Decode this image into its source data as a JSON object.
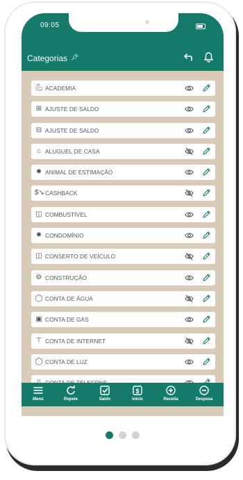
{
  "status": {
    "time": "09:05"
  },
  "header": {
    "title": "Categorias",
    "pin_icon": "pin-icon",
    "back_icon": "back-icon",
    "bell_icon": "bell-icon"
  },
  "categories": [
    {
      "label": "ACADEMIA",
      "icon": "dumbbell-icon",
      "hidden": false
    },
    {
      "label": "AJUSTE DE SALDO",
      "icon": "plus-box-icon",
      "hidden": false
    },
    {
      "label": "AJUSTE DE SALDO",
      "icon": "minus-box-icon",
      "hidden": false
    },
    {
      "label": "ALUGUEL DE CASA",
      "icon": "house-icon",
      "hidden": true
    },
    {
      "label": "ANIMAL DE ESTIMAÇÃO",
      "icon": "bone-icon",
      "hidden": false
    },
    {
      "label": "CASHBACK",
      "icon": "cashback-icon",
      "hidden": true
    },
    {
      "label": "COMBUSTÍVEL",
      "icon": "fuel-pump-icon",
      "hidden": false
    },
    {
      "label": "CONDOMÍNIO",
      "icon": "building-icon",
      "hidden": false
    },
    {
      "label": "CONSERTO DE VEÍCULO",
      "icon": "car-repair-icon",
      "hidden": true
    },
    {
      "label": "CONSTRUÇÃO",
      "icon": "worker-icon",
      "hidden": false
    },
    {
      "label": "CONTA DE ÁGUA",
      "icon": "water-drop-icon",
      "hidden": true
    },
    {
      "label": "CONTA DE GÁS",
      "icon": "gas-cylinder-icon",
      "hidden": false
    },
    {
      "label": "CONTA DE INTERNET",
      "icon": "router-icon",
      "hidden": true
    },
    {
      "label": "CONTA DE LUZ",
      "icon": "lightbulb-icon",
      "hidden": false
    },
    {
      "label": "CONTA DE TELEFONE",
      "icon": "phone-icon",
      "hidden": false
    }
  ],
  "bottom_nav": [
    {
      "label": "Menú",
      "icon": "menu-icon"
    },
    {
      "label": "Repete",
      "icon": "repeat-icon"
    },
    {
      "label": "Saldo",
      "icon": "check-box-icon"
    },
    {
      "label": "Inicio",
      "icon": "dollar-icon"
    },
    {
      "label": "Receita",
      "icon": "plus-circle-icon"
    },
    {
      "label": "Despesa",
      "icon": "minus-circle-icon"
    }
  ],
  "pagination": {
    "pages": 3,
    "active": 0
  },
  "colors": {
    "primary": "#147a6a",
    "list_background": "#d9cbb7",
    "row_background": "#ffffff",
    "text": "#555555",
    "dot_active": "#147a6a",
    "dot_inactive": "#d3d3d3"
  }
}
